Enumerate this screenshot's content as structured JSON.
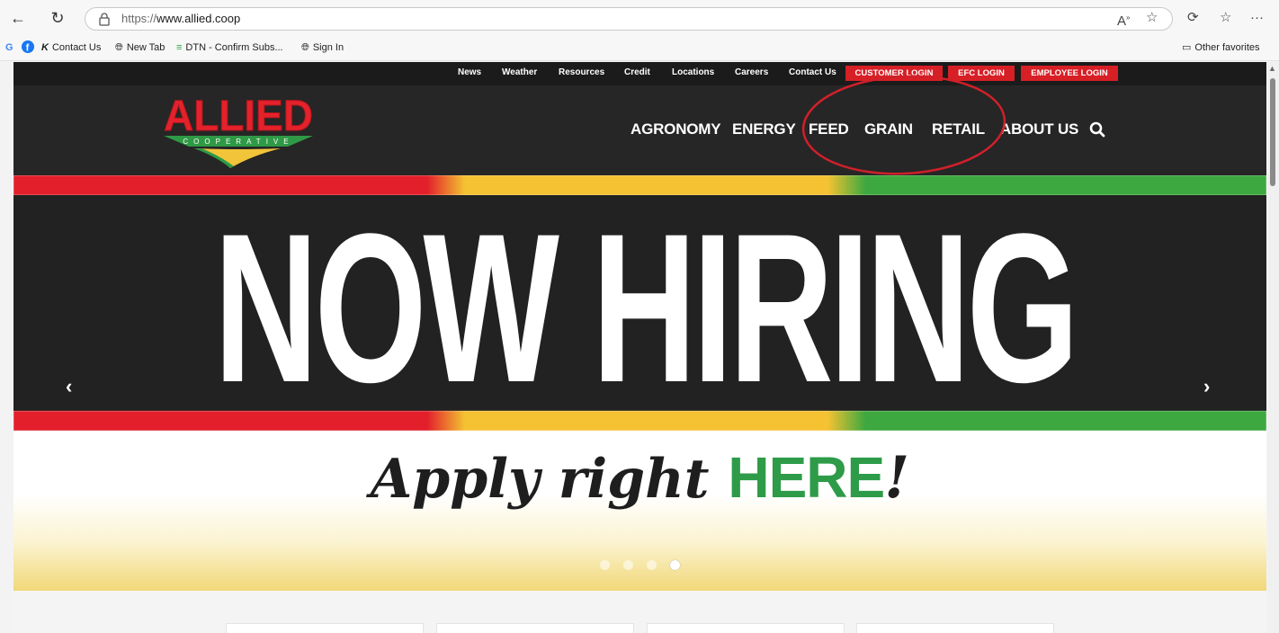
{
  "browser": {
    "url_protocol": "https://",
    "url_host": "www.allied.coop",
    "bookmarks": [
      {
        "label": "Contact Us",
        "icon": "k-logo-icon"
      },
      {
        "label": "New Tab",
        "icon": "globe-icon"
      },
      {
        "label": "DTN - Confirm Subs...",
        "icon": "dtn-icon"
      },
      {
        "label": "Sign In",
        "icon": "globe-icon"
      }
    ],
    "other_favorites": "Other favorites"
  },
  "site": {
    "utility_nav": [
      "News",
      "Weather",
      "Resources",
      "Credit",
      "Locations",
      "Careers",
      "Contact Us"
    ],
    "login_buttons": [
      "CUSTOMER LOGIN",
      "EFC LOGIN",
      "EMPLOYEE LOGIN"
    ],
    "logo": {
      "name": "ALLIED",
      "sub": "COOPERATIVE"
    },
    "main_nav": [
      "AGRONOMY",
      "ENERGY",
      "FEED",
      "GRAIN",
      "RETAIL",
      "ABOUT US"
    ]
  },
  "hero": {
    "headline": "NOW HIRING",
    "apply_script": "Apply right ",
    "apply_emphasis": "HERE",
    "apply_bang": "!",
    "slide_count": 4,
    "active_slide": 4
  },
  "colors": {
    "brand_red": "#d71f26",
    "brand_green": "#2e9b48",
    "brand_yellow": "#f4c232",
    "annotation_red": "#d0202a"
  }
}
